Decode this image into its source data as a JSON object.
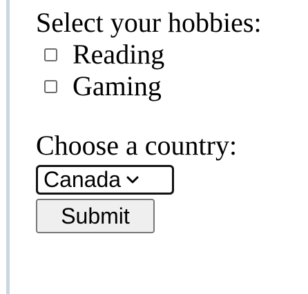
{
  "form": {
    "hobbies_label": "Select your hobbies:",
    "hobbies": [
      {
        "label": "Reading",
        "checked": false
      },
      {
        "label": "Gaming",
        "checked": false
      }
    ],
    "country_label": "Choose a country:",
    "country_selected": "Canada",
    "submit_label": "Submit"
  },
  "icons": {
    "select_arrow": "chevron-down-icon",
    "checkbox": "checkbox-unchecked"
  },
  "colors": {
    "left_rule": "#c9d8df",
    "button_bg": "#efefef",
    "text": "#000000"
  }
}
